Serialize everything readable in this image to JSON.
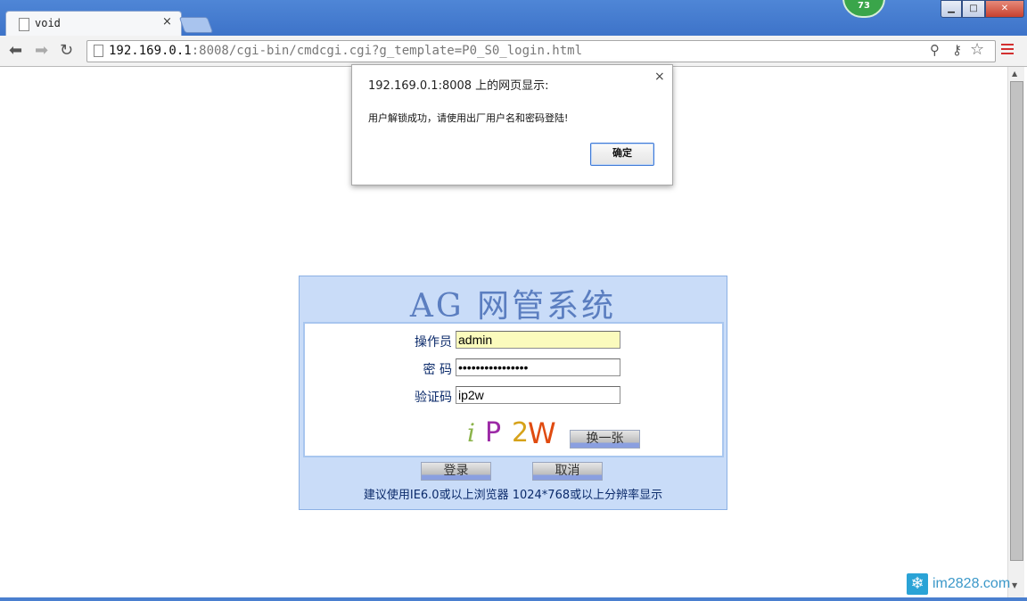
{
  "browser": {
    "tab_title": "void",
    "tab_close": "×",
    "extension_badge": "73",
    "window_buttons": {
      "minimize": "▁",
      "maximize": "□",
      "close": "✕"
    },
    "nav": {
      "back": "⬅",
      "forward": "➡",
      "reload": "↻"
    },
    "url_host": "192.169.0.1",
    "url_rest": ":8008/cgi-bin/cmdcgi.cgi?g_template=P0_S0_login.html",
    "icons": {
      "zoom": "⚲",
      "key": "⚷",
      "star": "☆"
    }
  },
  "dialog": {
    "title": "192.169.0.1:8008 上的网页显示:",
    "close": "×",
    "message": "用户解锁成功，请使用出厂用户名和密码登陆!",
    "ok_label": "确定"
  },
  "login": {
    "title": "AG 网管系统",
    "user_label": "操作员",
    "user_value": "admin",
    "password_label": "密 码",
    "password_value": "••••••••••••••••",
    "captcha_label": "验证码",
    "captcha_value": "ip2w",
    "captcha_image_text": "iP2W",
    "refresh_label": "换一张",
    "login_label": "登录",
    "cancel_label": "取消",
    "hint": "建议使用IE6.0或以上浏览器 1024*768或以上分辨率显示"
  },
  "watermark": {
    "text": "im2828.com",
    "icon": "❄"
  },
  "colors": {
    "title_blue": "#5b7ec0",
    "panel_bg": "#c9dcf8",
    "chrome_blue": "#3d73c9",
    "menu_red": "#d32f2f"
  }
}
